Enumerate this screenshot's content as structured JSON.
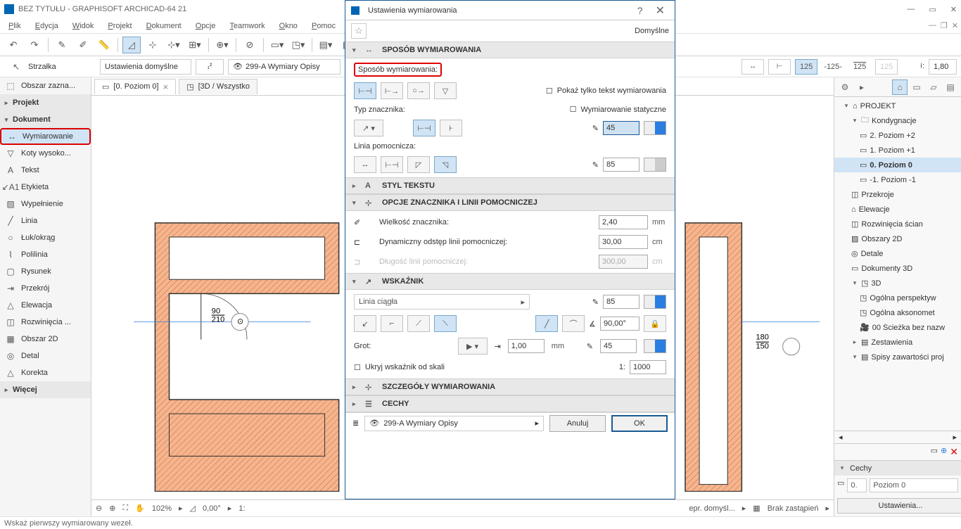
{
  "title": "BEZ TYTUŁU - GRAPHISOFT ARCHICAD-64 21",
  "menu": [
    "Plik",
    "Edycja",
    "Widok",
    "Projekt",
    "Dokument",
    "Opcje",
    "Teamwork",
    "Okno",
    "Pomoc"
  ],
  "tool_current": "Strzałka",
  "selection_label": "Obszar zazna...",
  "sidebar_groups": {
    "projekt": "Projekt",
    "dokument": "Dokument",
    "wiecej": "Więcej"
  },
  "sidebar_dokument_items": [
    "Wymiarowanie",
    "Koty wysoko...",
    "Tekst",
    "Etykieta",
    "Wypełnienie",
    "Linia",
    "Łuk/okrąg",
    "Polilinia",
    "Rysunek",
    "Przekrój",
    "Elewacja",
    "Rozwinięcia ...",
    "Obszar 2D",
    "Detal",
    "Korekta"
  ],
  "info_defaults": "Ustawienia domyślne",
  "info_layer": "299-A Wymiary Opisy",
  "dim_values": [
    "125",
    "-125-",
    "125",
    "125"
  ],
  "dim_height": "1,80",
  "tabs": [
    {
      "label": "[0. Poziom 0]",
      "active": true
    },
    {
      "label": "[3D / Wszystko",
      "active": false
    }
  ],
  "nav_root": "PROJEKT",
  "nav_kondygnacje": "Kondygnacje",
  "nav_levels": [
    "2. Poziom +2",
    "1. Poziom +1",
    "0. Poziom 0",
    "-1. Poziom -1"
  ],
  "nav_sections": [
    "Przekroje",
    "Elewacje",
    "Rozwinięcia ścian",
    "Obszary 2D",
    "Detale",
    "Dokumenty 3D"
  ],
  "nav_3d_head": "3D",
  "nav_3d_items": [
    "Ogólna perspektyw",
    "Ogólna aksonomet",
    "00 Ścieżka bez nazw"
  ],
  "nav_bottom": [
    "Zestawienia",
    "Spisy zawartości proj"
  ],
  "cechy_head": "Cechy",
  "cechy_lvl_short": "0.",
  "cechy_lvl_long": "Poziom 0",
  "settings_btn": "Ustawienia...",
  "status": {
    "zoom": "102%",
    "angle": "0,00°",
    "repr": "epr. domyśl...",
    "brak": "Brak zastąpień"
  },
  "footer_hint": "Wskaż pierwszy wymiarowany wezeł.",
  "plan_labels": {
    "w90": "90",
    "w210": "210",
    "h180": "180",
    "h150": "150"
  },
  "dialog": {
    "title": "Ustawienia wymiarowania",
    "default": "Domyślne",
    "sect_sposob": "SPOSÓB WYMIAROWANIA",
    "sposob_label": "Sposób wymiarowania:",
    "pokaz_tekst": "Pokaż tylko tekst wymiarowania",
    "wym_static": "Wymiarowanie statyczne",
    "typ_znacz": "Typ znacznika:",
    "linia_pom": "Linia pomocnicza:",
    "val45": "45",
    "val85": "85",
    "sect_styl": "STYL TEKSTU",
    "sect_opcje": "OPCJE ZNACZNIKA I LINII POMOCNICZEJ",
    "wielkosc": "Wielkość znacznika:",
    "wielkosc_val": "2,40",
    "wielkosc_u": "mm",
    "dyn_odst": "Dynamiczny odstęp linii pomocniczej:",
    "dyn_val": "30,00",
    "dyn_u": "cm",
    "dlugosc": "Długość linii pomocniczej:",
    "dlugosc_val": "300,00",
    "dlugosc_u": "cm",
    "sect_wskaznik": "WSKAŹNIK",
    "linia_ciagla": "Linia ciągła",
    "wsk85": "85",
    "angle90": "90,00°",
    "grot": "Grot:",
    "grot_val": "1,00",
    "grot_u": "mm",
    "grot_pen": "45",
    "ukryj": "Ukryj wskaźnik od skali",
    "scale_prefix": "1:",
    "scale_val": "1000",
    "sect_szczeg": "SZCZEGÓŁY WYMIAROWANIA",
    "sect_cechy": "CECHY",
    "layer": "299-A Wymiary Opisy",
    "btn_cancel": "Anuluj",
    "btn_ok": "OK"
  }
}
